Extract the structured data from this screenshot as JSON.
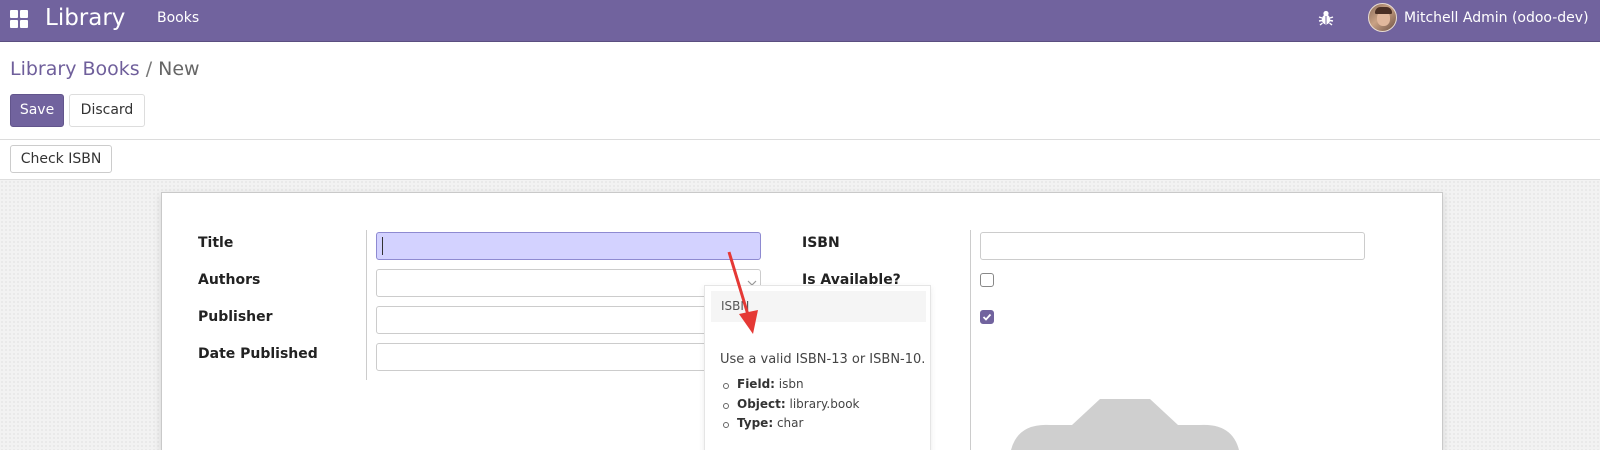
{
  "navbar": {
    "brand": "Library",
    "menu_item": "Books",
    "user_name": "Mitchell Admin (odoo-dev)",
    "icons": [
      "apps-grid-icon",
      "bug-icon",
      "avatar"
    ],
    "color": "#71639e"
  },
  "breadcrumb": {
    "parent": "Library Books",
    "separator": " / ",
    "current": "New"
  },
  "buttons": {
    "save": "Save",
    "discard": "Discard",
    "check_isbn": "Check ISBN"
  },
  "form": {
    "left_fields": [
      {
        "label": "Title",
        "value": ""
      },
      {
        "label": "Authors",
        "value": ""
      },
      {
        "label": "Publisher",
        "value": ""
      },
      {
        "label": "Date Published",
        "value": ""
      }
    ],
    "right_fields": [
      {
        "label": "ISBN",
        "value": ""
      },
      {
        "label": "Is Available?",
        "checked": false
      },
      {
        "label": "",
        "checked": true
      }
    ]
  },
  "tooltip": {
    "title": "ISBN",
    "help": "Use a valid ISBN-13 or ISBN-10.",
    "details": [
      {
        "key": "Field:",
        "value": " isbn"
      },
      {
        "key": "Object:",
        "value": " library.book"
      },
      {
        "key": "Type:",
        "value": " char"
      }
    ]
  },
  "colors": {
    "accent": "#71639e",
    "focus_field": "#d3d2ff",
    "annotation_arrow": "#e53935"
  }
}
